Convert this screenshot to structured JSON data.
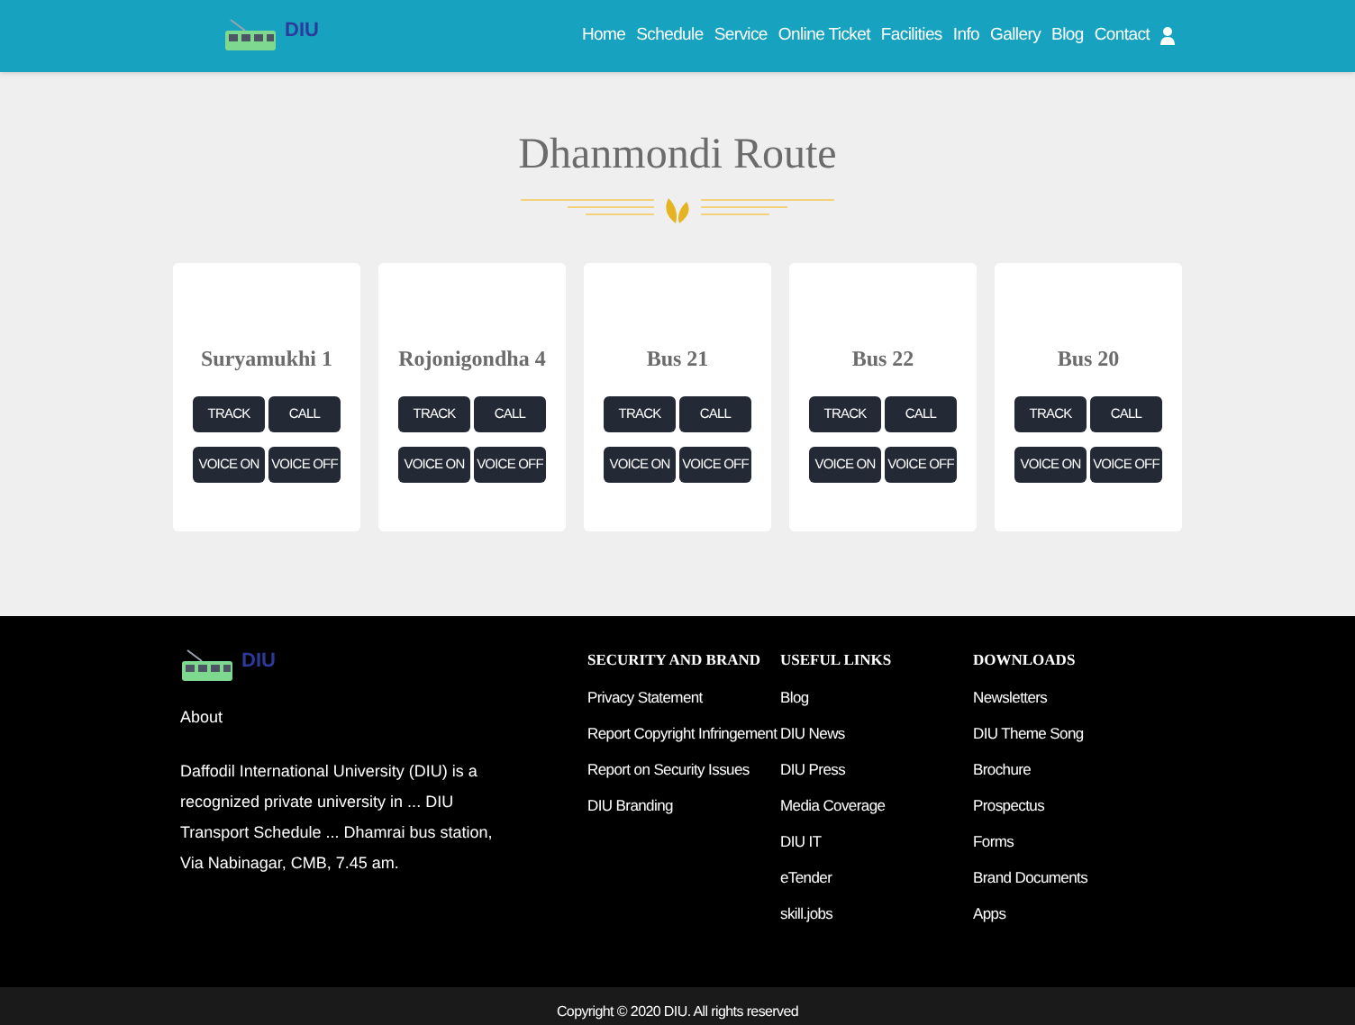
{
  "header": {
    "logo_text": "DIU",
    "nav": [
      {
        "label": "Home"
      },
      {
        "label": "Schedule"
      },
      {
        "label": "Service"
      },
      {
        "label": "Online Ticket"
      },
      {
        "label": "Facilities"
      },
      {
        "label": "Info"
      },
      {
        "label": "Gallery"
      },
      {
        "label": "Blog"
      },
      {
        "label": "Contact"
      }
    ]
  },
  "route": {
    "title": "Dhanmondi Route"
  },
  "buses": [
    {
      "name": "Suryamukhi 1",
      "buttons": [
        "TRACK",
        "CALL",
        "VOICE ON",
        "VOICE OFF"
      ]
    },
    {
      "name": "Rojonigondha 4",
      "buttons": [
        "TRACK",
        "CALL",
        "VOICE ON",
        "VOICE OFF"
      ]
    },
    {
      "name": "Bus 21",
      "buttons": [
        "TRACK",
        "CALL",
        "VOICE ON",
        "VOICE OFF"
      ]
    },
    {
      "name": "Bus 22",
      "buttons": [
        "TRACK",
        "CALL",
        "VOICE ON",
        "VOICE OFF"
      ]
    },
    {
      "name": "Bus 20",
      "buttons": [
        "TRACK",
        "CALL",
        "VOICE ON",
        "VOICE OFF"
      ]
    }
  ],
  "footer": {
    "logo_text": "DIU",
    "about_heading": "About",
    "about_text": "Daffodil International University (DIU) is a recognized private university in ... DIU Transport Schedule ... Dhamrai bus station, Via Nabinagar, CMB, 7.45 am.",
    "columns": [
      {
        "heading": "SECURITY AND BRAND",
        "links": [
          "Privacy Statement",
          "Report Copyright Infringement",
          "Report on Security Issues",
          "DIU Branding"
        ]
      },
      {
        "heading": "USEFUL LINKS",
        "links": [
          "Blog",
          "DIU News",
          "DIU Press",
          "Media Coverage",
          "DIU IT",
          "eTender",
          "skill.jobs"
        ]
      },
      {
        "heading": "DOWNLOADS",
        "links": [
          "Newsletters",
          "DIU Theme Song",
          "Brochure",
          "Prospectus",
          "Forms",
          "Brand Documents",
          "Apps"
        ]
      }
    ],
    "copyright": "Copyright © 2020 DIU. All rights reserved"
  }
}
